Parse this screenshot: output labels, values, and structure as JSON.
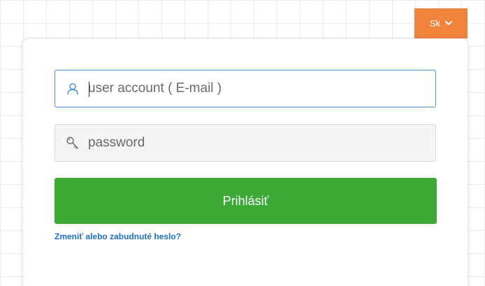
{
  "header": {
    "language_label": "Sk"
  },
  "login": {
    "username_placeholder": "user account ( E-mail )",
    "password_placeholder": "password",
    "submit_label": "Prihlásiť",
    "forgot_link": "Zmeniť alebo zabudnuté heslo?"
  },
  "icons": {
    "user": "user-icon",
    "password": "key-icon",
    "dropdown": "chevron-down-icon"
  },
  "colors": {
    "accent_orange": "#f0843c",
    "primary_green": "#3aa935",
    "link_blue": "#1d72c8",
    "focus_blue": "#4a90d6",
    "icon_blue": "#3b8fd8",
    "icon_gray": "#666666"
  }
}
